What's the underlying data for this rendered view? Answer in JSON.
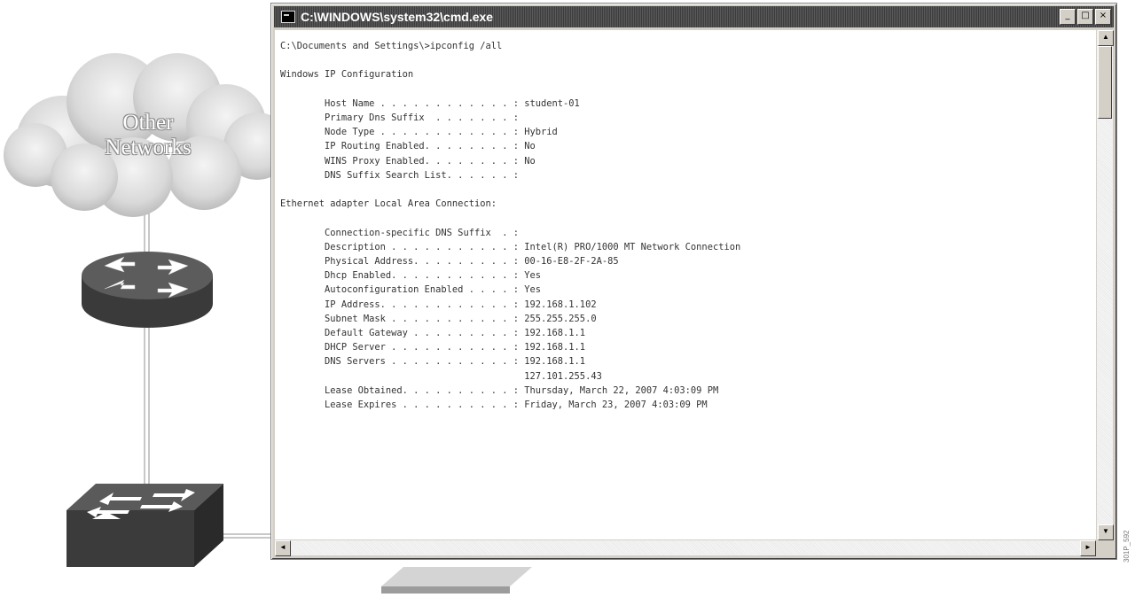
{
  "cloud": {
    "label_line1": "Other",
    "label_line2": "Networks"
  },
  "window": {
    "title": "C:\\WINDOWS\\system32\\cmd.exe",
    "minimize_glyph": "_",
    "maximize_glyph": "□",
    "close_glyph": "×",
    "scroll_up_glyph": "▲",
    "scroll_down_glyph": "▼",
    "scroll_left_glyph": "◄",
    "scroll_right_glyph": "►"
  },
  "console": {
    "lines": [
      "C:\\Documents and Settings\\>ipconfig /all",
      "",
      "Windows IP Configuration",
      "",
      "        Host Name . . . . . . . . . . . . : student-01",
      "        Primary Dns Suffix  . . . . . . . :",
      "        Node Type . . . . . . . . . . . . : Hybrid",
      "        IP Routing Enabled. . . . . . . . : No",
      "        WINS Proxy Enabled. . . . . . . . : No",
      "        DNS Suffix Search List. . . . . . :",
      "",
      "Ethernet adapter Local Area Connection:",
      "",
      "        Connection-specific DNS Suffix  . :",
      "        Description . . . . . . . . . . . : Intel(R) PRO/1000 MT Network Connection",
      "        Physical Address. . . . . . . . . : 00-16-E8-2F-2A-85",
      "        Dhcp Enabled. . . . . . . . . . . : Yes",
      "        Autoconfiguration Enabled . . . . : Yes",
      "        IP Address. . . . . . . . . . . . : 192.168.1.102",
      "        Subnet Mask . . . . . . . . . . . : 255.255.255.0",
      "        Default Gateway . . . . . . . . . : 192.168.1.1",
      "        DHCP Server . . . . . . . . . . . : 192.168.1.1",
      "        DNS Servers . . . . . . . . . . . : 192.168.1.1",
      "                                            127.101.255.43",
      "        Lease Obtained. . . . . . . . . . : Thursday, March 22, 2007 4:03:09 PM",
      "        Lease Expires . . . . . . . . . . : Friday, March 23, 2007 4:03:09 PM"
    ]
  },
  "figure_id": "301P_592"
}
